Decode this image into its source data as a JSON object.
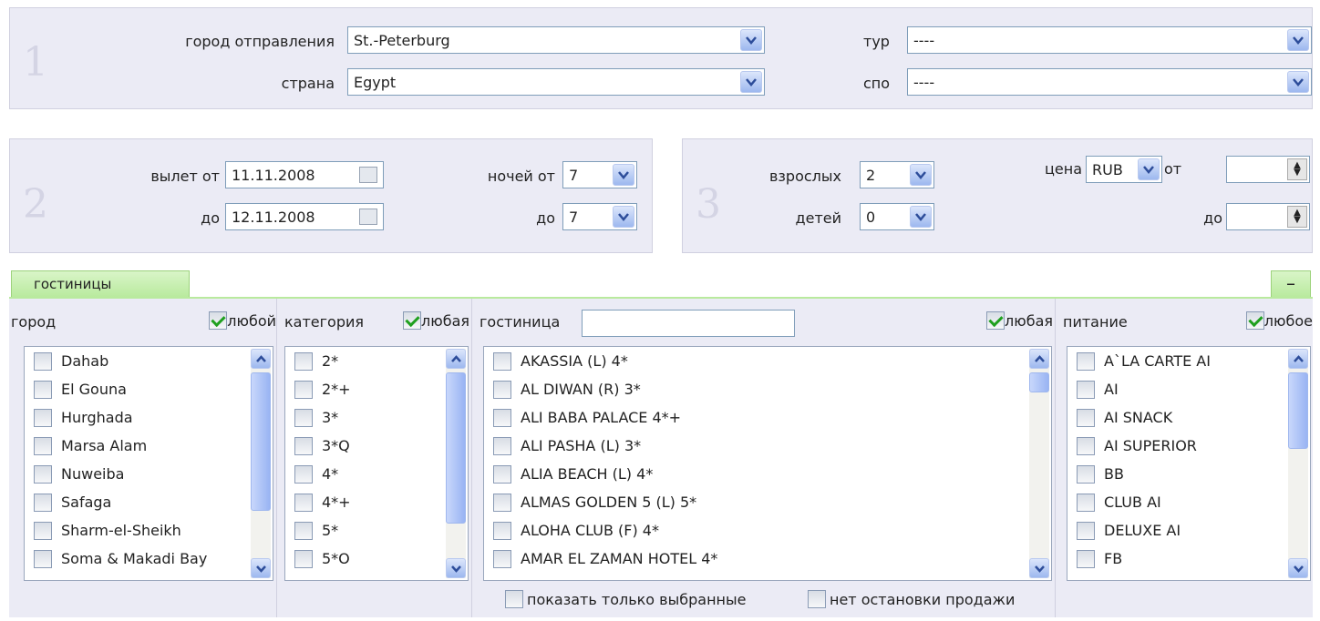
{
  "section1": {
    "number": "1",
    "departure_label": "город отправления",
    "departure_value": "St.-Peterburg",
    "country_label": "страна",
    "country_value": "Egypt",
    "tour_label": "тур",
    "tour_value": "----",
    "spo_label": "спо",
    "spo_value": "----"
  },
  "section2": {
    "number": "2",
    "depart_from_label": "вылет от",
    "depart_from_value": "11.11.2008",
    "depart_to_label": "до",
    "depart_to_value": "12.11.2008",
    "nights_from_label": "ночей от",
    "nights_from_value": "7",
    "nights_to_label": "до",
    "nights_to_value": "7"
  },
  "section3": {
    "number": "3",
    "adults_label": "взрослых",
    "adults_value": "2",
    "children_label": "детей",
    "children_value": "0",
    "price_label": "цена",
    "currency_value": "RUB",
    "price_from_label": "от",
    "price_to_label": "до"
  },
  "hotels": {
    "tab_label": "гостиницы",
    "collapse_label": "–",
    "city": {
      "header": "город",
      "any_label": "любой",
      "any_checked": true,
      "items": [
        "Dahab",
        "El Gouna",
        "Hurghada",
        "Marsa Alam",
        "Nuweiba",
        "Safaga",
        "Sharm-el-Sheikh",
        "Soma & Makadi Bay"
      ]
    },
    "category": {
      "header": "категория",
      "any_label": "любая",
      "any_checked": true,
      "items": [
        "2*",
        "2*+",
        "3*",
        "3*Q",
        "4*",
        "4*+",
        "5*",
        "5*O"
      ]
    },
    "hotel": {
      "header": "гостиница",
      "search_value": "",
      "any_label": "любая",
      "any_checked": true,
      "items": [
        "AKASSIA (L) 4*",
        "AL DIWAN (R) 3*",
        "ALI BABA PALACE 4*+",
        "ALI PASHA (L) 3*",
        "ALIA BEACH (L) 4*",
        "ALMAS GOLDEN 5 (L) 5*",
        "ALOHA CLUB (F) 4*",
        "AMAR EL ZAMAN HOTEL 4*"
      ],
      "show_selected_label": "показать только выбранные",
      "no_stop_sale_label": "нет остановки продажи"
    },
    "meal": {
      "header": "питание",
      "any_label": "любое",
      "any_checked": true,
      "items": [
        "A`LA CARTE AI",
        "AI",
        "AI SNACK",
        "AI SUPERIOR",
        "BB",
        "CLUB AI",
        "DELUXE AI",
        "FB"
      ]
    }
  },
  "colors": {
    "panel": "#ebebf5",
    "tab_green": "#b9ea9e",
    "check_green": "#1fa01f"
  }
}
